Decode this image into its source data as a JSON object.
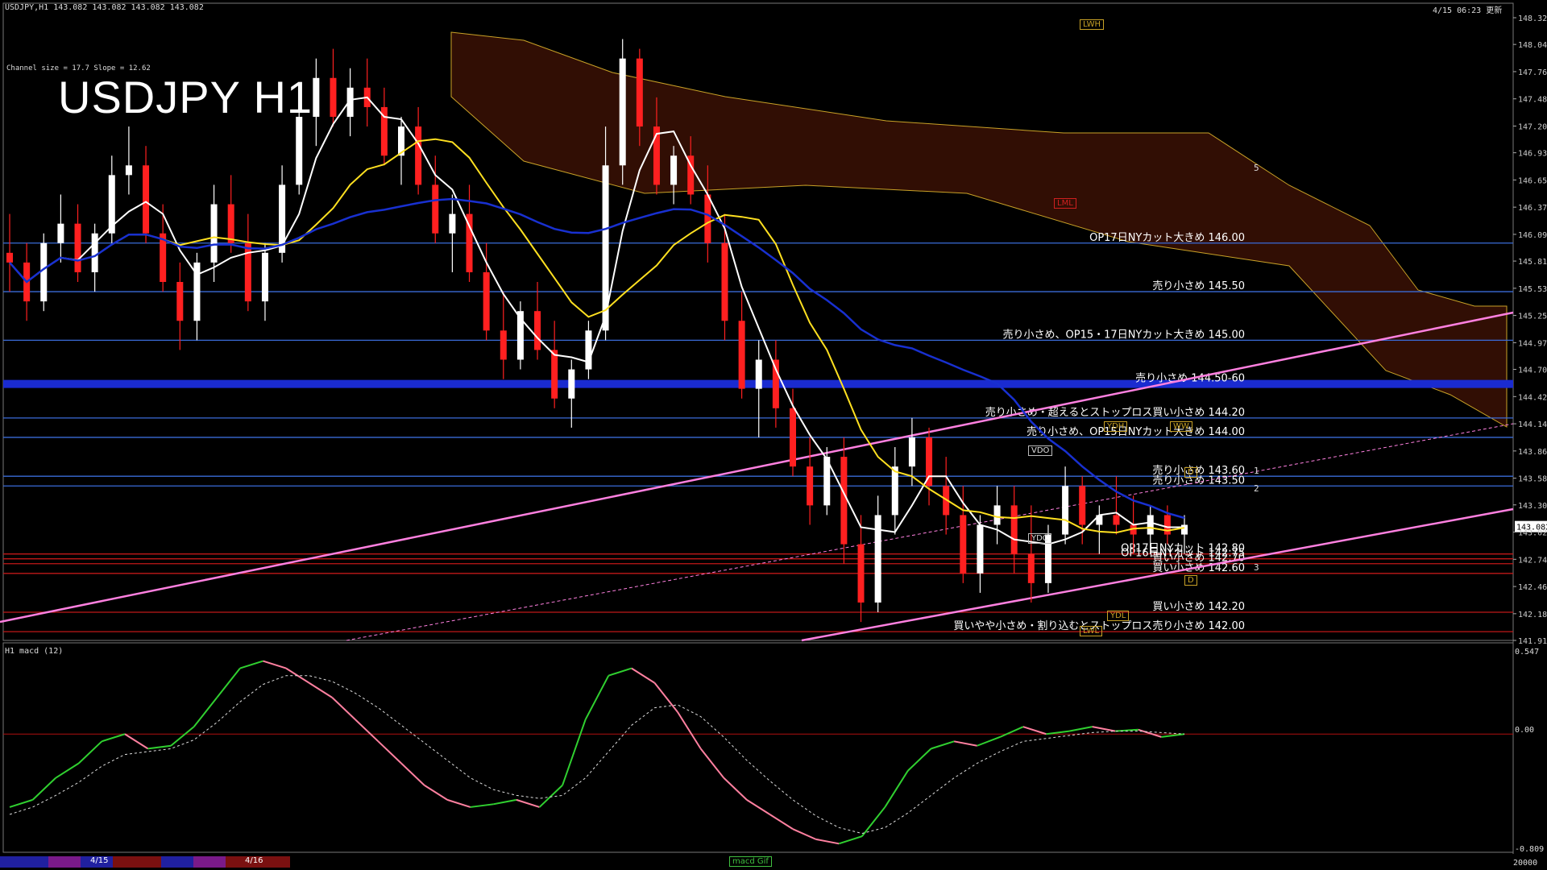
{
  "header": {
    "symbol_info": "USDJPY,H1  143.082 143.082 143.082 143.082",
    "datetime": "4/15 06:23 更新",
    "title": "USDJPY H1",
    "channel_info": "Channel size = 17.7  Slope = 12.62"
  },
  "macd_panel": {
    "label": "H1  macd (12)",
    "top_value": "0.547",
    "zero_value": "0.00",
    "bottom_value": "-0.809",
    "footer_value": "20000"
  },
  "bottom_bar": {
    "date1": "4/15",
    "date2": "4/16",
    "tab": "macd Gif"
  },
  "colors": {
    "bull_candle": "#ffffff",
    "bear_candle": "#ff2020",
    "level_line": "#3a6bd8",
    "support_line": "#c01818",
    "trend_channel": "#ff80e0",
    "ma_white": "#ffffff",
    "ma_yellow": "#ffe020",
    "ma_blue": "#1830d0",
    "macd_up": "#30d030",
    "macd_down": "#ff80a0"
  },
  "badges": [
    {
      "id": "lwh",
      "text": "LWH"
    },
    {
      "id": "lml",
      "text": "LML"
    },
    {
      "id": "ydh",
      "text": "YDH"
    },
    {
      "id": "vdo",
      "text": "VDO"
    },
    {
      "id": "ydc",
      "text": "YDC"
    },
    {
      "id": "ydl",
      "text": "YDL"
    },
    {
      "id": "lwl",
      "text": "LWL"
    },
    {
      "id": "ww",
      "text": "WW"
    },
    {
      "id": "d1",
      "text": "D"
    },
    {
      "id": "d2",
      "text": "D"
    }
  ],
  "scenario_labels": [
    "1",
    "2",
    "3",
    "5"
  ],
  "chart_data": {
    "type": "candlestick",
    "symbol": "USDJPY",
    "timeframe": "H1",
    "ylim": [
      141.91,
      148.32
    ],
    "y_ticks": [
      "148.320",
      "148.045",
      "147.765",
      "147.485",
      "147.205",
      "146.930",
      "146.650",
      "146.370",
      "146.090",
      "145.815",
      "145.535",
      "145.255",
      "144.975",
      "144.700",
      "144.420",
      "144.140",
      "143.860",
      "143.580",
      "143.305",
      "143.025",
      "142.745",
      "142.465",
      "142.185",
      "141.910"
    ],
    "current_price": "143.082",
    "current_price_aux": "143.025",
    "levels": [
      {
        "price": 146.0,
        "text": "OP17日NYカット大きめ 146.00",
        "color": "#3a6bd8"
      },
      {
        "price": 145.5,
        "text": "売り小さめ 145.50",
        "color": "#3a6bd8"
      },
      {
        "price": 145.0,
        "text": "売り小さめ、OP15・17日NYカット大きめ 145.00",
        "color": "#3a6bd8"
      },
      {
        "price": 144.55,
        "text": "売り小さめ 144.50-60",
        "color": "#1a2bd0",
        "band": true
      },
      {
        "price": 144.2,
        "text": "売り小さめ・超えるとストップロス買い小さめ 144.20",
        "color": "#3a6bd8"
      },
      {
        "price": 144.0,
        "text": "売り小さめ、OP15日NYカット大きめ 144.00",
        "color": "#3a6bd8"
      },
      {
        "price": 143.6,
        "text": "売り小さめ 143.60",
        "color": "#3a6bd8"
      },
      {
        "price": 143.5,
        "text": "売り小さめ 143.50",
        "color": "#3a6bd8"
      },
      {
        "price": 142.8,
        "text": "OP17日NYカット 142.80",
        "color": "#c01818"
      },
      {
        "price": 142.75,
        "text": "OP16日NYカット 142.75",
        "color": "#c01818"
      },
      {
        "price": 142.7,
        "text": "買い小さめ 142.70",
        "color": "#c01818"
      },
      {
        "price": 142.6,
        "text": "買い小さめ 142.60",
        "color": "#c01818"
      },
      {
        "price": 142.2,
        "text": "買い小さめ 142.20",
        "color": "#c01818"
      },
      {
        "price": 142.0,
        "text": "買いやや小さめ・割り込むとストップロス売り小さめ 142.00",
        "color": "#c01818"
      }
    ],
    "candles": [
      [
        145.9,
        146.3,
        145.5,
        145.8
      ],
      [
        145.8,
        146.0,
        145.2,
        145.4
      ],
      [
        145.4,
        146.1,
        145.3,
        146.0
      ],
      [
        146.0,
        146.5,
        145.8,
        146.2
      ],
      [
        146.2,
        146.4,
        145.6,
        145.7
      ],
      [
        145.7,
        146.2,
        145.5,
        146.1
      ],
      [
        146.1,
        146.9,
        146.0,
        146.7
      ],
      [
        146.7,
        147.2,
        146.5,
        146.8
      ],
      [
        146.8,
        147.0,
        146.0,
        146.1
      ],
      [
        146.1,
        146.4,
        145.5,
        145.6
      ],
      [
        145.6,
        145.8,
        144.9,
        145.2
      ],
      [
        145.2,
        145.9,
        145.0,
        145.8
      ],
      [
        145.8,
        146.6,
        145.6,
        146.4
      ],
      [
        146.4,
        146.7,
        145.9,
        146.0
      ],
      [
        146.0,
        146.3,
        145.3,
        145.4
      ],
      [
        145.4,
        146.0,
        145.2,
        145.9
      ],
      [
        145.9,
        146.8,
        145.8,
        146.6
      ],
      [
        146.6,
        147.5,
        146.5,
        147.3
      ],
      [
        147.3,
        147.9,
        147.0,
        147.7
      ],
      [
        147.7,
        148.0,
        147.2,
        147.3
      ],
      [
        147.3,
        147.8,
        147.1,
        147.6
      ],
      [
        147.6,
        147.9,
        147.2,
        147.4
      ],
      [
        147.4,
        147.6,
        146.8,
        146.9
      ],
      [
        146.9,
        147.3,
        146.6,
        147.2
      ],
      [
        147.2,
        147.4,
        146.5,
        146.6
      ],
      [
        146.6,
        146.9,
        146.0,
        146.1
      ],
      [
        146.1,
        146.5,
        145.7,
        146.3
      ],
      [
        146.3,
        146.6,
        145.6,
        145.7
      ],
      [
        145.7,
        146.0,
        145.0,
        145.1
      ],
      [
        145.1,
        145.5,
        144.6,
        144.8
      ],
      [
        144.8,
        145.4,
        144.7,
        145.3
      ],
      [
        145.3,
        145.6,
        144.8,
        144.9
      ],
      [
        144.9,
        145.2,
        144.3,
        144.4
      ],
      [
        144.4,
        144.8,
        144.1,
        144.7
      ],
      [
        144.7,
        145.2,
        144.6,
        145.1
      ],
      [
        145.1,
        147.2,
        145.0,
        146.8
      ],
      [
        146.8,
        148.1,
        146.6,
        147.9
      ],
      [
        147.9,
        148.0,
        147.0,
        147.2
      ],
      [
        147.2,
        147.5,
        146.5,
        146.6
      ],
      [
        146.6,
        147.0,
        146.4,
        146.9
      ],
      [
        146.9,
        147.1,
        146.4,
        146.5
      ],
      [
        146.5,
        146.8,
        145.8,
        146.0
      ],
      [
        146.0,
        146.3,
        145.0,
        145.2
      ],
      [
        145.2,
        145.5,
        144.4,
        144.5
      ],
      [
        144.5,
        145.0,
        144.0,
        144.8
      ],
      [
        144.8,
        145.0,
        144.1,
        144.3
      ],
      [
        144.3,
        144.5,
        143.6,
        143.7
      ],
      [
        143.7,
        144.0,
        143.1,
        143.3
      ],
      [
        143.3,
        143.9,
        143.2,
        143.8
      ],
      [
        143.8,
        144.0,
        142.7,
        142.9
      ],
      [
        142.9,
        143.2,
        142.1,
        142.3
      ],
      [
        142.3,
        143.4,
        142.2,
        143.2
      ],
      [
        143.2,
        143.9,
        143.0,
        143.7
      ],
      [
        143.7,
        144.2,
        143.5,
        144.0
      ],
      [
        144.0,
        144.1,
        143.3,
        143.5
      ],
      [
        143.5,
        143.8,
        143.0,
        143.2
      ],
      [
        143.2,
        143.5,
        142.5,
        142.6
      ],
      [
        142.6,
        143.2,
        142.4,
        143.1
      ],
      [
        143.1,
        143.5,
        142.9,
        143.3
      ],
      [
        143.3,
        143.5,
        142.6,
        142.8
      ],
      [
        142.8,
        143.3,
        142.3,
        142.5
      ],
      [
        142.5,
        143.1,
        142.4,
        143.0
      ],
      [
        143.0,
        143.7,
        142.9,
        143.5
      ],
      [
        143.5,
        143.6,
        142.9,
        143.1
      ],
      [
        143.1,
        143.3,
        142.8,
        143.2
      ],
      [
        143.2,
        143.6,
        143.0,
        143.1
      ],
      [
        143.1,
        143.4,
        142.8,
        143.0
      ],
      [
        143.0,
        143.3,
        142.8,
        143.2
      ],
      [
        143.2,
        143.3,
        142.9,
        143.0
      ],
      [
        143.0,
        143.2,
        142.8,
        143.1
      ]
    ],
    "macd": {
      "ylim": [
        -0.809,
        0.547
      ],
      "main": [
        -0.5,
        -0.45,
        -0.3,
        -0.2,
        -0.05,
        0.0,
        -0.1,
        -0.08,
        0.05,
        0.25,
        0.45,
        0.5,
        0.45,
        0.35,
        0.25,
        0.1,
        -0.05,
        -0.2,
        -0.35,
        -0.45,
        -0.5,
        -0.48,
        -0.45,
        -0.5,
        -0.35,
        0.1,
        0.4,
        0.45,
        0.35,
        0.15,
        -0.1,
        -0.3,
        -0.45,
        -0.55,
        -0.65,
        -0.72,
        -0.75,
        -0.7,
        -0.5,
        -0.25,
        -0.1,
        -0.05,
        -0.08,
        -0.02,
        0.05,
        0.0,
        0.02,
        0.05,
        0.02,
        0.03,
        -0.02,
        0.0
      ],
      "signal": [
        -0.55,
        -0.5,
        -0.42,
        -0.33,
        -0.22,
        -0.14,
        -0.12,
        -0.1,
        -0.04,
        0.08,
        0.22,
        0.34,
        0.4,
        0.4,
        0.36,
        0.28,
        0.18,
        0.06,
        -0.06,
        -0.18,
        -0.3,
        -0.38,
        -0.42,
        -0.44,
        -0.42,
        -0.3,
        -0.12,
        0.06,
        0.18,
        0.2,
        0.12,
        -0.02,
        -0.18,
        -0.32,
        -0.45,
        -0.56,
        -0.64,
        -0.68,
        -0.64,
        -0.54,
        -0.42,
        -0.3,
        -0.2,
        -0.12,
        -0.05,
        -0.03,
        -0.01,
        0.01,
        0.02,
        0.02,
        0.01,
        0.0
      ]
    }
  }
}
